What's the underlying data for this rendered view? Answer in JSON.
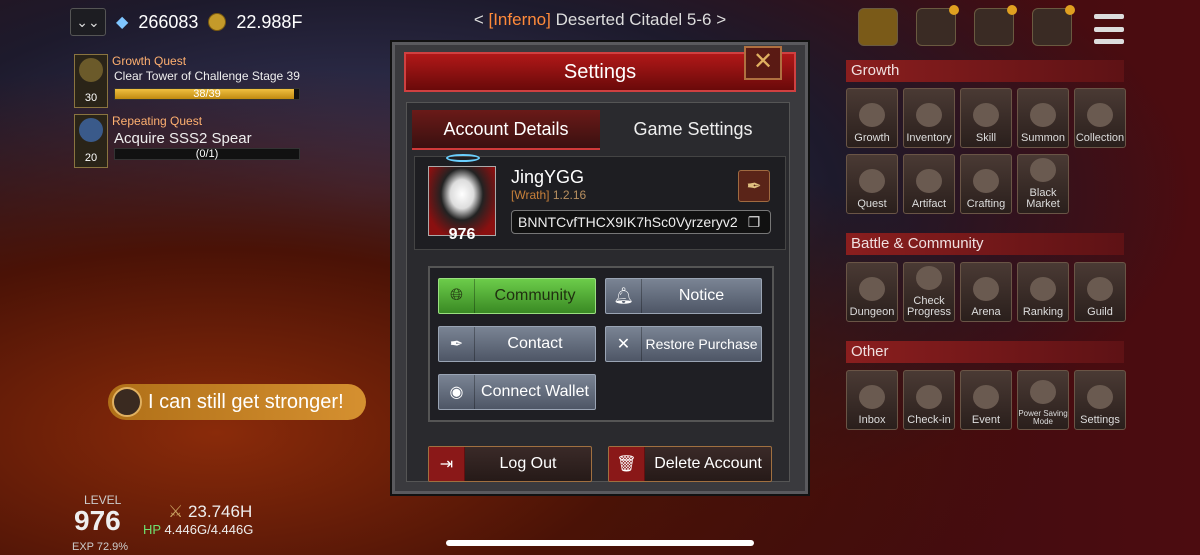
{
  "topbar": {
    "diamonds": "266083",
    "gold": "22.988F",
    "stage_prefix": "< ",
    "stage_mode": "[Inferno]",
    "stage_name": " Deserted Citadel 5-6 >"
  },
  "quests": [
    {
      "type": "Growth Quest",
      "desc": "Clear Tower of Challenge Stage 39",
      "progress": "38/39",
      "level": "30",
      "fill": 0.974
    },
    {
      "type": "Repeating Quest",
      "desc": "Acquire SSS2 Spear",
      "progress": "(0/1)",
      "level": "20",
      "fill": 0.0
    }
  ],
  "menu": {
    "growth_header": "Growth",
    "growth": [
      "Growth",
      "Inventory",
      "Skill",
      "Summon",
      "Collection"
    ],
    "growth2": [
      "Quest",
      "Artifact",
      "Crafting",
      "Black Market"
    ],
    "battle_header": "Battle & Community",
    "battle": [
      "Dungeon",
      "Check Progress",
      "Arena",
      "Ranking",
      "Guild"
    ],
    "other_header": "Other",
    "other": [
      "Inbox",
      "Check-in",
      "Event",
      "Power Saving Mode",
      "Settings"
    ]
  },
  "status": {
    "message": "I can still get stronger!",
    "level_label": "LEVEL",
    "level": "976",
    "exp": "EXP 72.9%",
    "power": "23.746H",
    "hp_label": "HP",
    "hp": "4.446G/4.446G"
  },
  "dialog": {
    "title": "Settings",
    "tabs": [
      "Account Details",
      "Game Settings"
    ],
    "account": {
      "name": "JingYGG",
      "guild": "[Wrath]",
      "version": "1.2.16",
      "level": "976",
      "uid": "BNNTCvfTHCX9IK7hSc0Vyrzeryv2"
    },
    "buttons": {
      "community": "Community",
      "notice": "Notice",
      "contact": "Contact",
      "restore": "Restore Purchase",
      "wallet": "Connect Wallet",
      "logout": "Log Out",
      "delete": "Delete Account"
    }
  }
}
